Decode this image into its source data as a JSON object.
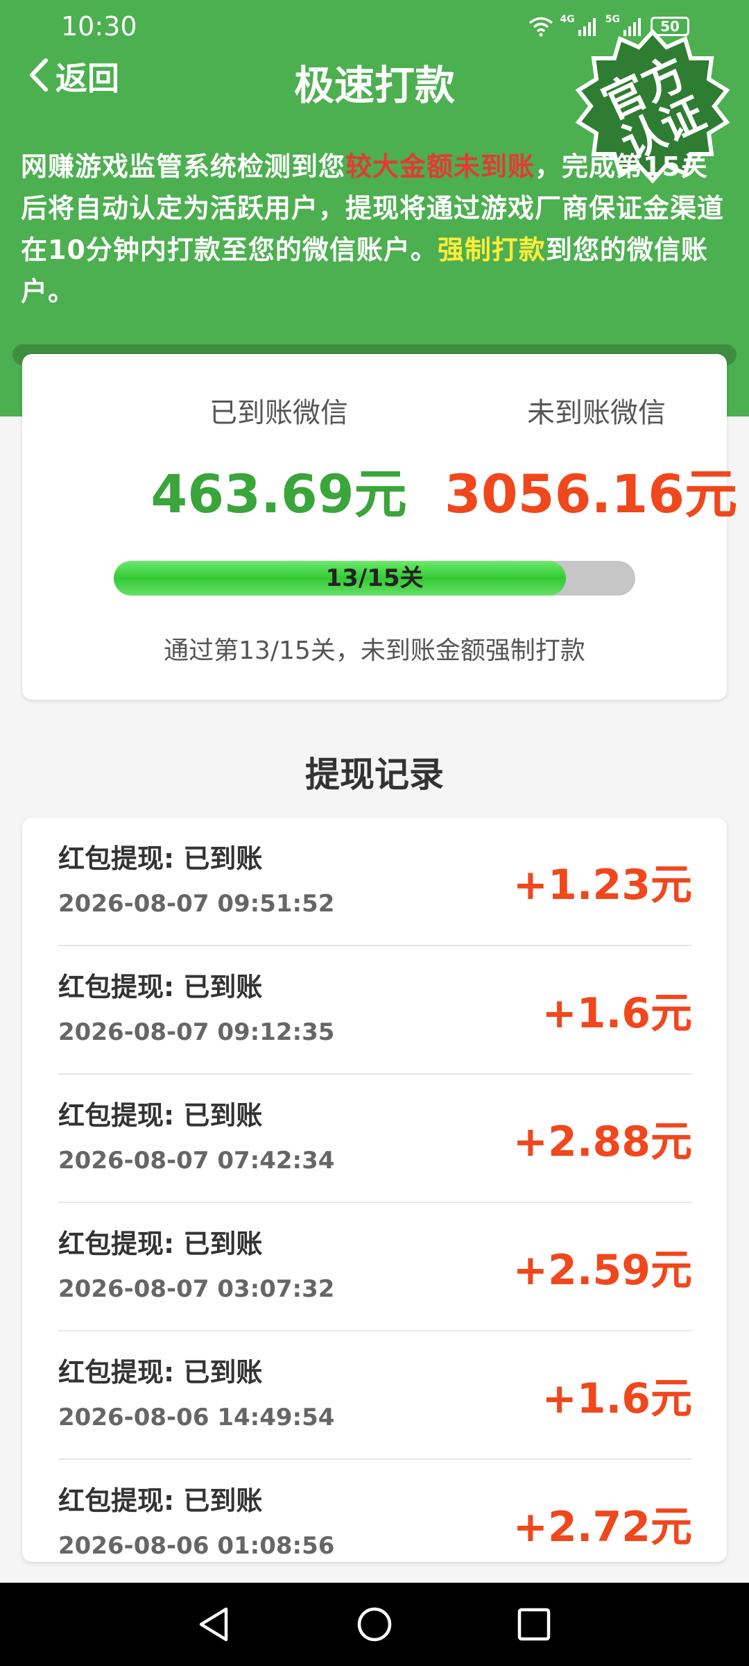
{
  "status_bar": {
    "time": "10:30",
    "net_left": "4G",
    "net_right": "5G",
    "battery": "50"
  },
  "header": {
    "back_label": "返回",
    "title": "极速打款",
    "seal_lines": [
      "官方",
      "认证"
    ]
  },
  "intro": {
    "part1": "网赚游戏监管系统检测到您",
    "highlight_red": "较大金额未到账",
    "part2": "，完成第15关后将自动认定为活跃用户，提现将通过游戏厂商保证金渠道在10分钟内打款至您的微信账户。",
    "highlight_yellow": "强制打款",
    "part3": "到您的微信账户。"
  },
  "summary": {
    "arrived_label": "已到账微信",
    "arrived_amount": "463.69元",
    "pending_label": "未到账微信",
    "pending_amount": "3056.16元",
    "progress_text": "13/15关",
    "progress_current": 13,
    "progress_total": 15,
    "note": "通过第13/15关，未到账金额强制打款"
  },
  "records": {
    "title": "提现记录",
    "items": [
      {
        "label": "红包提现: 已到账",
        "time": "2026-08-07 09:51:52",
        "amount": "+1.23元"
      },
      {
        "label": "红包提现: 已到账",
        "time": "2026-08-07 09:12:35",
        "amount": "+1.6元"
      },
      {
        "label": "红包提现: 已到账",
        "time": "2026-08-07 07:42:34",
        "amount": "+2.88元"
      },
      {
        "label": "红包提现: 已到账",
        "time": "2026-08-07 03:07:32",
        "amount": "+2.59元"
      },
      {
        "label": "红包提现: 已到账",
        "time": "2026-08-06 14:49:54",
        "amount": "+1.6元"
      },
      {
        "label": "红包提现: 已到账",
        "time": "2026-08-06 01:08:56",
        "amount": "+2.72元"
      }
    ]
  },
  "colors": {
    "header_green": "#4caf50",
    "amount_green": "#3aa53a",
    "amount_red": "#f0471c",
    "highlight_red": "#e53935",
    "highlight_yellow": "#ffeb3b",
    "seal_green": "#2e7d32"
  },
  "icons": {
    "back": "chevron-left-icon",
    "wifi": "wifi-icon",
    "signal": "signal-icon",
    "battery": "battery-icon",
    "nav_back": "triangle-back-icon",
    "nav_home": "circle-home-icon",
    "nav_recents": "square-recents-icon"
  }
}
